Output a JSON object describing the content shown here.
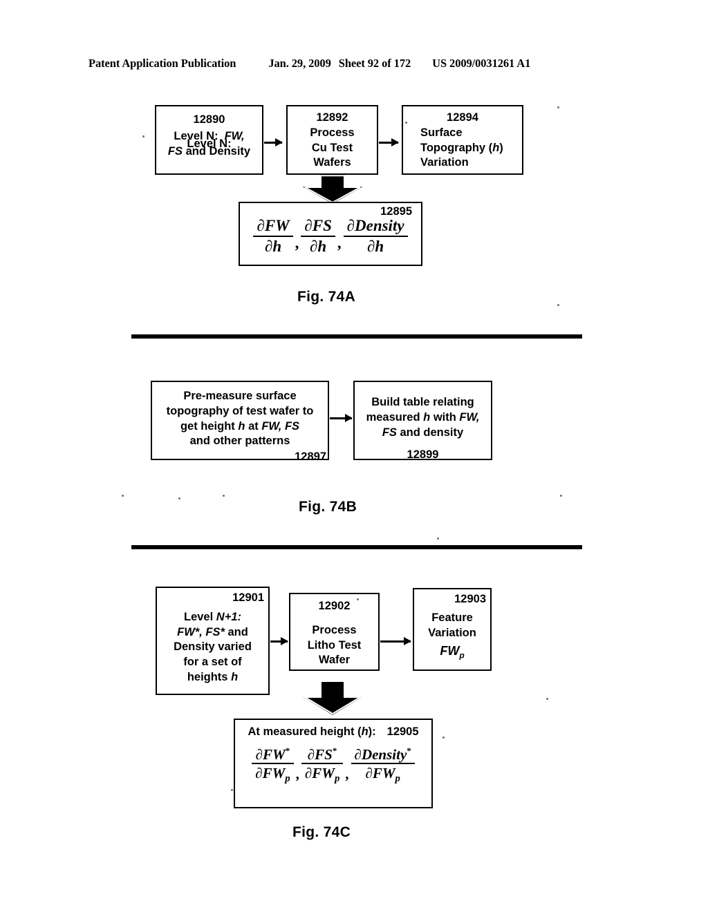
{
  "header": {
    "publication": "Patent Application Publication",
    "date": "Jan. 29, 2009",
    "sheet": "Sheet 92 of 172",
    "patent_number": "US 2009/0031261 A1"
  },
  "figures": [
    {
      "id": "fig-74a",
      "caption": "Fig. 74A",
      "boxes": [
        {
          "ref": "12890",
          "line1": "Level N:",
          "line1b": "FW,",
          "line2a": "FS",
          "line2b": "and Density"
        },
        {
          "ref": "12892",
          "line1": "Process",
          "line2": "Cu Test",
          "line3": "Wafers"
        },
        {
          "ref": "12894",
          "line1": "Surface",
          "line2a": "Topography (",
          "line2b": "h",
          "line2c": ")",
          "line3": "Variation"
        }
      ],
      "formula_box": {
        "ref": "12895",
        "terms": [
          {
            "numerator": "FW",
            "denominator": "h"
          },
          {
            "numerator": "FS",
            "denominator": "h"
          },
          {
            "numerator": "Density",
            "denominator": "h"
          }
        ],
        "separator": ","
      }
    },
    {
      "id": "fig-74b",
      "caption": "Fig. 74B",
      "boxes": [
        {
          "ref": "12897",
          "line1": "Pre-measure surface",
          "line2": "topography of test wafer to",
          "line3a": "get height",
          "line3b": "h",
          "line3c": "at",
          "line3d": "FW, FS",
          "line4": "and other patterns"
        },
        {
          "ref": "12899",
          "line1": "Build table relating",
          "line2a": "measured",
          "line2b": "h",
          "line2c": "with",
          "line2d": "FW,",
          "line3a": "FS",
          "line3b": "and density"
        }
      ]
    },
    {
      "id": "fig-74c",
      "caption": "Fig. 74C",
      "boxes": [
        {
          "ref": "12901",
          "line1a": "Level",
          "line1b": "N+1:",
          "line2a": "FW*, FS*",
          "line2b": "and",
          "line3": "Density varied",
          "line4": "for a set of",
          "line5a": "heights",
          "line5b": "h"
        },
        {
          "ref": "12902",
          "line1": "Process",
          "line2": "Litho Test",
          "line3": "Wafer"
        },
        {
          "ref": "12903",
          "line1": "Feature",
          "line2": "Variation",
          "line3_base": "FW",
          "line3_sub": "p"
        }
      ],
      "formula_box": {
        "ref": "12905",
        "title_a": "At measured height (",
        "title_b": "h",
        "title_c": "):",
        "terms": [
          {
            "numerator_base": "FW",
            "numerator_star": "*",
            "denominator_base": "FW",
            "denominator_sub": "p"
          },
          {
            "numerator_base": "FS",
            "numerator_star": "*",
            "denominator_base": "FW",
            "denominator_sub": "p"
          },
          {
            "numerator_base": "Density",
            "numerator_star": "*",
            "denominator_base": "FW",
            "denominator_sub": "p"
          }
        ],
        "separator": ","
      }
    }
  ],
  "symbols": {
    "partial": "∂"
  }
}
